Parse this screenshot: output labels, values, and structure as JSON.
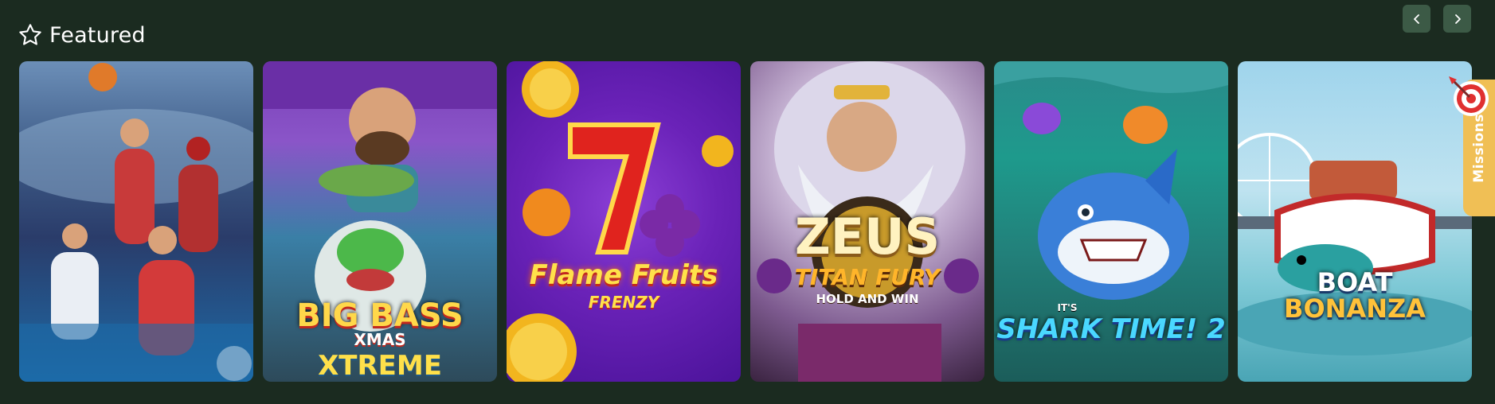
{
  "section": {
    "title": "Featured",
    "icon": "star-icon"
  },
  "navigation": {
    "prev_icon": "chevron-left-icon",
    "next_icon": "chevron-right-icon"
  },
  "games": [
    {
      "title": ""
    },
    {
      "title": "BIG BASS",
      "subtitle": "XMAS",
      "extra": "XTREME"
    },
    {
      "title": "Flame Fruits",
      "subtitle": "FRENZY"
    },
    {
      "title": "ZEUS",
      "subtitle": "TITAN FURY",
      "extra": "HOLD AND WIN"
    },
    {
      "title": "IT'S",
      "subtitle": "SHARK TIME! 2"
    },
    {
      "title": "BOAT",
      "subtitle": "BONANZA"
    }
  ],
  "missions": {
    "label": "Missions",
    "icon": "target-icon"
  },
  "colors": {
    "background": "#1b2b20",
    "nav_button": "#3c5a46",
    "missions_tab": "#f0bf55"
  }
}
